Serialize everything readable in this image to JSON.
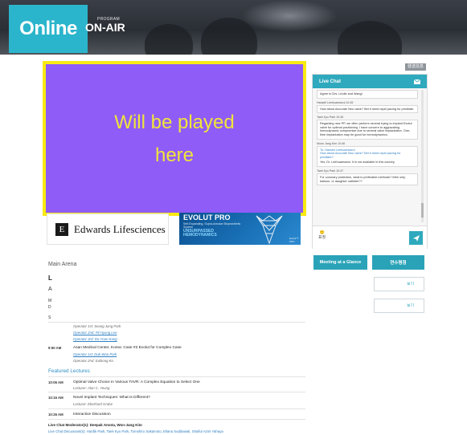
{
  "banner": {
    "badge": "Online",
    "program_small": "PROGRAM",
    "title": "ON-AIR"
  },
  "top_button": "發送信息",
  "player": {
    "text": "Will be played\nhere"
  },
  "sponsors": {
    "edwards": {
      "mark": "E",
      "name": "Edwards Lifesciences"
    },
    "evolut": {
      "title": "EVOLUT PRO",
      "sub": "Self-Expanding, Supra-Annular Bioprosthetic System",
      "tag": "UNSURPASSED HEMODYNAMICS",
      "logo": "Evolut™ PRO"
    }
  },
  "chat": {
    "title": "Live Chat",
    "messages": [
      {
        "name": "",
        "text": "Agree to Drs. Lindle and Wang!"
      },
      {
        "name": "Hanseil Leehuaesseul 10:45",
        "text": "How about Accurate Neo valve? Bet it need rapid pacing for predilate."
      },
      {
        "name": "Taek Kyu Park 10:45",
        "text": "Regarding new PP, we often perform several trying to implant Evolut valve for optimal positioning. I have concern to aggravating hemodynamic compromise due to several valve implantation. One-time implantation may be good for hemodynamics."
      },
      {
        "name": "Moon Jang Kim 10:46",
        "quote": "To: Hanseil Leehuaesseul\nHow about Accurate Neo valve? Bet it need rapid pacing for predilate?",
        "text": "Yes, Dr. Leehuaesseul. It is not available in this country."
      },
      {
        "name": "Taek Kyu Park 10:47",
        "text": "For coronary protection, what is preferable methods? Wire only, balloon, or daughter catheter??"
      }
    ],
    "emoji_label": "🙂",
    "emoji_text": "표정"
  },
  "actions": {
    "meeting_glance": "Meeting at a Glance",
    "program_book": "연수평점",
    "outline1": "보기",
    "outline2": "보기"
  },
  "program": {
    "arena": "Main Arena",
    "hidden_head": "L",
    "hidden_sub": "A",
    "hidden_lines": [
      "M",
      "D"
    ],
    "hidden_s": "S",
    "ops_a": [
      "Operator 1st: Seung Jung Park",
      "Operator 2nd: Pil Hyung Lee",
      "Operator 3rd: Do-Yoon Kang"
    ],
    "case_time": "9:50 AM",
    "case_title": "Asan Medical Center, Korea: Case #2 Evolut for Complex Case",
    "ops_b": [
      "Operator 1st: Duk-Woo Park",
      "Operator 2nd: Euihong Ko"
    ],
    "featured": "Featured Lectures",
    "lectures": [
      {
        "time": "10:06 AM",
        "title": "Optimal Valve Choice in Various TAVR: A Complex Equation to Select One",
        "lecturer": "Lecturer: Alan C. Yeung"
      },
      {
        "time": "10:16 AM",
        "title": "Novel Implant Techniques: What Is Different?",
        "lecturer": "Lecturer: Eberhard Grube"
      },
      {
        "time": "10:26 AM",
        "title": "Interactive Discussion",
        "lecturer": ""
      }
    ],
    "moderators": "Live Chat Moderator(s): Deepak Amota, Won-Jang Kim",
    "discussants": "Live Chat Discussant(s): Hardik Park, Taek Kyu Park, Tomohiro Sakamoto, Eliana Suddawati, Shafiul Azmi Yahaya"
  },
  "colors": {
    "accent": "#2aa3b8",
    "player_bg": "#8f5cf7",
    "player_border": "#f9e913",
    "player_text": "#f1e53a"
  }
}
